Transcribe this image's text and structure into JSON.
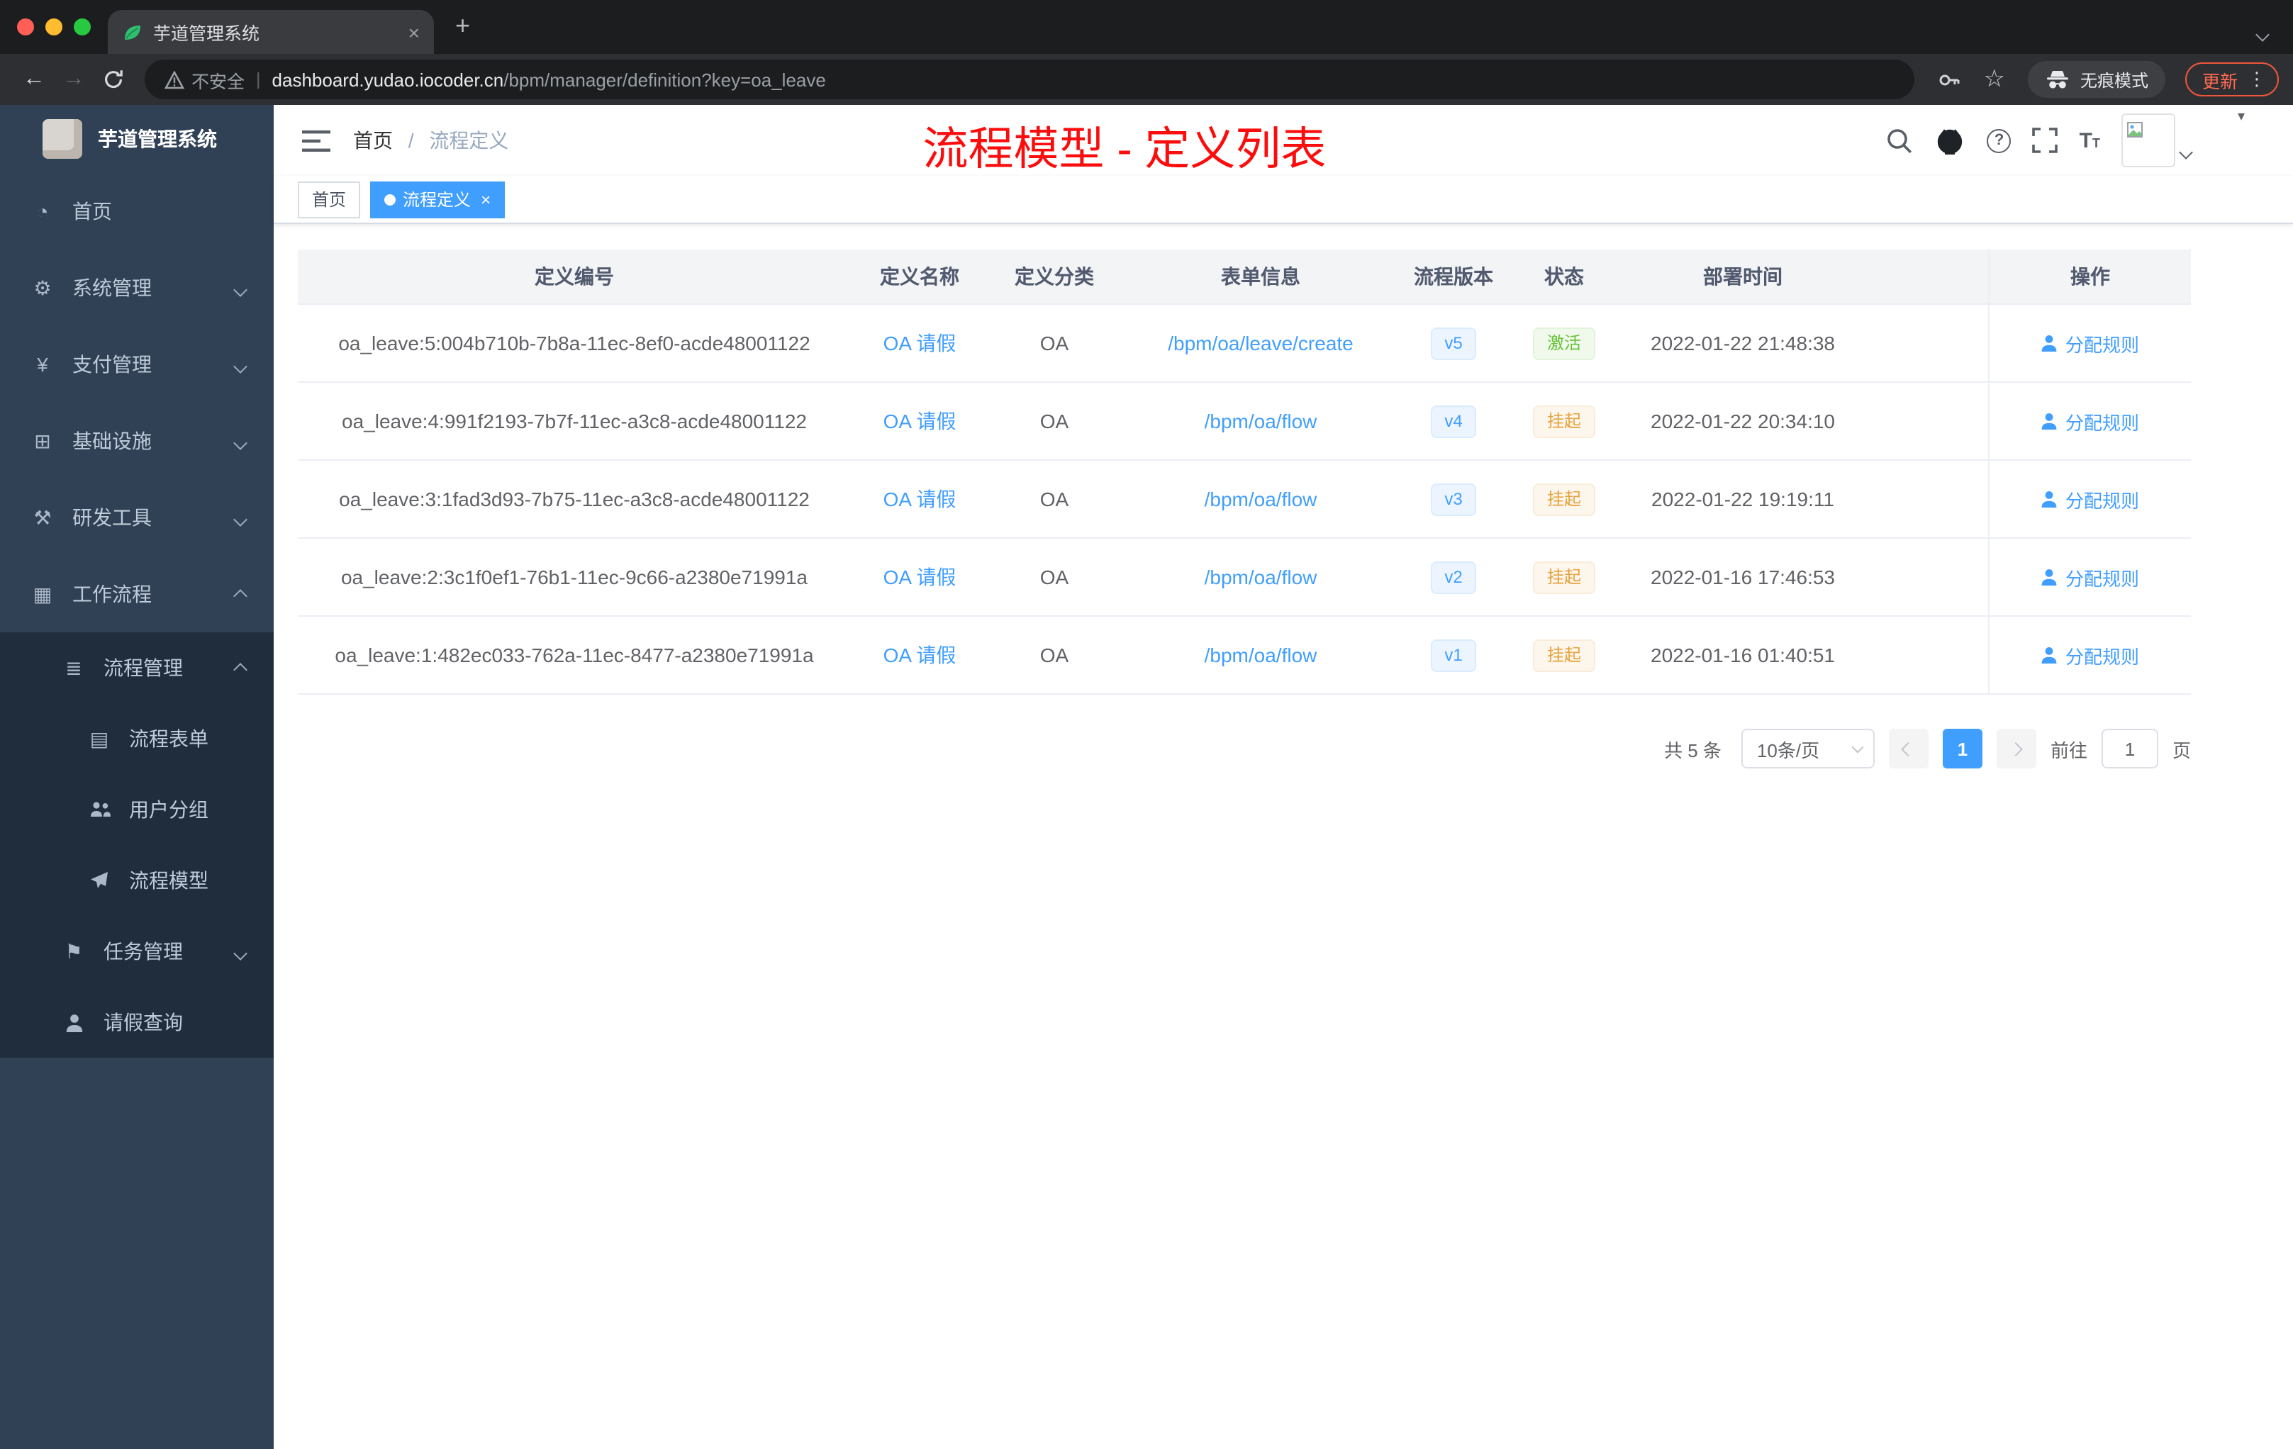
{
  "browser": {
    "tab_title": "芋道管理系统",
    "security_label": "不安全",
    "url_host": "dashboard.yudao.iocoder.cn",
    "url_path": "/bpm/manager/definition?key=oa_leave",
    "incognito_label": "无痕模式",
    "update_label": "更新"
  },
  "sidebar": {
    "logo_title": "芋道管理系统",
    "items": [
      {
        "label": "首页",
        "icon": "dashboard-icon"
      },
      {
        "label": "系统管理",
        "icon": "gear-icon"
      },
      {
        "label": "支付管理",
        "icon": "yen-icon"
      },
      {
        "label": "基础设施",
        "icon": "infrastructure-icon"
      },
      {
        "label": "研发工具",
        "icon": "tools-icon"
      },
      {
        "label": "工作流程",
        "icon": "workflow-icon"
      },
      {
        "label": "流程管理",
        "icon": "process-list-icon"
      },
      {
        "label": "流程表单",
        "icon": "form-icon"
      },
      {
        "label": "用户分组",
        "icon": "user-group-icon"
      },
      {
        "label": "流程模型",
        "icon": "paper-plane-icon"
      },
      {
        "label": "任务管理",
        "icon": "flag-icon"
      },
      {
        "label": "请假查询",
        "icon": "person-icon"
      }
    ]
  },
  "header": {
    "breadcrumb_home": "首页",
    "breadcrumb_sep": "/",
    "breadcrumb_current": "流程定义",
    "annotation": "流程模型 - 定义列表"
  },
  "tags": {
    "home": "首页",
    "active": "流程定义"
  },
  "table": {
    "columns": [
      "定义编号",
      "定义名称",
      "定义分类",
      "表单信息",
      "流程版本",
      "状态",
      "部署时间",
      "操作"
    ],
    "rows": [
      {
        "id": "oa_leave:5:004b710b-7b8a-11ec-8ef0-acde48001122",
        "name": "OA 请假",
        "category": "OA",
        "form": "/bpm/oa/leave/create",
        "version": "v5",
        "status": "激活",
        "status_type": "active",
        "time": "2022-01-22 21:48:38",
        "action": "分配规则"
      },
      {
        "id": "oa_leave:4:991f2193-7b7f-11ec-a3c8-acde48001122",
        "name": "OA 请假",
        "category": "OA",
        "form": "/bpm/oa/flow",
        "version": "v4",
        "status": "挂起",
        "status_type": "suspended",
        "time": "2022-01-22 20:34:10",
        "action": "分配规则"
      },
      {
        "id": "oa_leave:3:1fad3d93-7b75-11ec-a3c8-acde48001122",
        "name": "OA 请假",
        "category": "OA",
        "form": "/bpm/oa/flow",
        "version": "v3",
        "status": "挂起",
        "status_type": "suspended",
        "time": "2022-01-22 19:19:11",
        "action": "分配规则"
      },
      {
        "id": "oa_leave:2:3c1f0ef1-76b1-11ec-9c66-a2380e71991a",
        "name": "OA 请假",
        "category": "OA",
        "form": "/bpm/oa/flow",
        "version": "v2",
        "status": "挂起",
        "status_type": "suspended",
        "time": "2022-01-16 17:46:53",
        "action": "分配规则"
      },
      {
        "id": "oa_leave:1:482ec033-762a-11ec-8477-a2380e71991a",
        "name": "OA 请假",
        "category": "OA",
        "form": "/bpm/oa/flow",
        "version": "v1",
        "status": "挂起",
        "status_type": "suspended",
        "time": "2022-01-16 01:40:51",
        "action": "分配规则"
      }
    ]
  },
  "pagination": {
    "total": "共 5 条",
    "page_size": "10条/页",
    "current": "1",
    "goto": "前往",
    "goto_value": "1",
    "unit": "页"
  },
  "colors": {
    "accent_blue": "#409eff",
    "sidebar_bg": "#304156",
    "submenu_bg": "#1f2d3d",
    "status_active_green": "#67c23a",
    "status_suspended_orange": "#e6a23c",
    "annotation_red": "#fb0d0d",
    "active_tag_blue": "#409eff",
    "update_button_red": "#f0573a"
  }
}
